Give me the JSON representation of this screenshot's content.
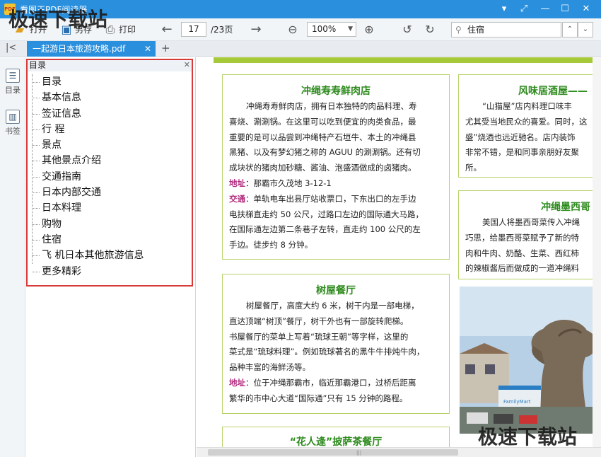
{
  "window": {
    "app_title": "看图王PDF阅读器",
    "app_icon_text": "PDF"
  },
  "toolbar": {
    "open_label": "打开",
    "save_as_label": "另存",
    "print_label": "打印",
    "current_page": "17",
    "total_pages": "/23页",
    "zoom": "100%",
    "search_value": "住宿"
  },
  "tabs": {
    "doc_tab": "一起游日本旅游攻略.pdf"
  },
  "leftrail": {
    "toc_label": "目录",
    "bookmark_label": "书签"
  },
  "toc": {
    "header": "目录",
    "items": [
      "目录",
      "基本信息",
      "签证信息",
      "行 程",
      "景点",
      "其他景点介绍",
      "交通指南",
      "日本内部交通",
      "日本料理",
      "购物",
      "住宿",
      "飞 机日本其他旅游信息",
      "更多精彩"
    ]
  },
  "cards": {
    "okinawa_sushi": {
      "title": "冲绳寿寿鲜肉店",
      "lines": [
        "冲绳寿寿鲜肉店，拥有日本独特的肉品料理、寿",
        "喜烧、涮涮锅。在这里可以吃到便宜的肉类食品，最",
        "重要的是可以品尝到冲绳特产石垣牛、本土的冲绳县",
        "黑猪、以及有梦幻猪之称的 AGUU 的涮涮锅。还有切",
        "成块状的猪肉加砂糖、酱油、泡盛酒做成的卤猪肉。"
      ],
      "address_label": "地址",
      "address": "：那霸市久茂地 3-12-1",
      "transport_label": "交通",
      "transport_lines": [
        "：单轨电车出县厅站收票口，下东出口的左手边",
        "电扶梯直走约 50 公尺，过路口左边的国际通大马路，",
        "在国际通左边第二条巷子左转，直走约 100 公尺的左",
        "手边。徒步约 8 分钟。"
      ]
    },
    "tree_house": {
      "title": "树屋餐厅",
      "lines": [
        "树屋餐厅，高度大约 6 米，树干内是一部电梯，",
        "直达顶端“树顶”餐厅，树干外也有一部旋转爬梯。",
        "书屋餐厅的菜单上写着“琉球王朝”等字样，这里的",
        "菜式是“琉球料理”。例如琉球著名的黑牛牛排炖牛肉，",
        "品种丰富的海鲜汤等。"
      ],
      "address_label": "地址",
      "address_lines": [
        "：位于冲绳那霸市，临近那霸港口，过桥后距离",
        "繁华的市中心大道“国际通”只有 15 分钟的路程。"
      ]
    },
    "pizza": {
      "title": "“花人逢”披萨茶餐厅"
    },
    "izakaya": {
      "title": "风味居酒屋——",
      "lines": [
        "“山猫屋”店内料理口味丰",
        "尤其受当地民众的喜爱。同时，这",
        "盛”烧酒也远近驰名。店内装饰",
        "非常不错，是和同事亲朋好友聚",
        "所。"
      ]
    },
    "mexican": {
      "title": "冲绳墨西哥",
      "lines": [
        "美国人将墨西哥菜传入冲绳",
        "巧思，给墨西哥菜赋予了新的特",
        "肉和牛肉、奶酪、生菜、西红柿",
        "的辣椒酱后而做成的一道冲绳料"
      ]
    }
  },
  "photo": {
    "sign_text": "FamilyMart"
  },
  "watermarks": {
    "top": "极速下载站",
    "bottom": "极速下载站"
  },
  "colors": {
    "title_bar": "#2a8fdd",
    "card_border": "#b8d36a",
    "card_title": "#2e8b1e",
    "label": "#b0287c",
    "toc_highlight": "#d83a3a",
    "page_topbar": "#a6c93a"
  }
}
